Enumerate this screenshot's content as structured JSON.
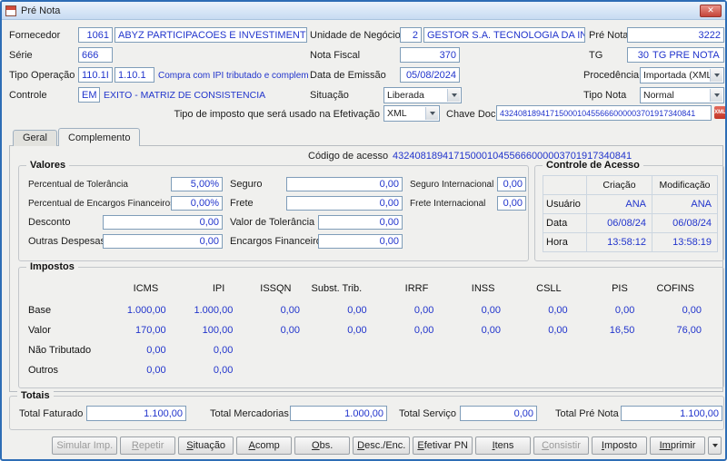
{
  "window": {
    "title": "Pré Nota",
    "close_icon": "✕"
  },
  "header": {
    "fornecedor": {
      "label": "Fornecedor",
      "code": "1061",
      "name": "ABYZ PARTICIPACOES E INVESTIMENTOS LTDA"
    },
    "unidade_negocio": {
      "label": "Unidade de Negócio",
      "code": "2",
      "name": "GESTOR S.A. TECNOLOGIA DA INFORMACA"
    },
    "pre_nota": {
      "label": "Pré Nota",
      "value": "3222"
    },
    "serie": {
      "label": "Série",
      "value": "666"
    },
    "nota_fiscal": {
      "label": "Nota Fiscal",
      "value": "370"
    },
    "tg": {
      "label": "TG",
      "code": "30",
      "name": "TG PRE NOTA POI"
    },
    "tipo_operacao": {
      "label": "Tipo Operação",
      "code1": "110.1I",
      "code2": "1.10.1",
      "desc": "Compra com IPI tributado e complemento"
    },
    "data_emissao": {
      "label": "Data de Emissão",
      "value": "05/08/2024"
    },
    "procedencia": {
      "label": "Procedência",
      "value": "Importada (XML)"
    },
    "controle": {
      "label": "Controle",
      "code": "EM",
      "desc": "EXITO - MATRIZ DE CONSISTENCIA"
    },
    "situacao": {
      "label": "Situação",
      "value": "Liberada"
    },
    "tipo_nota": {
      "label": "Tipo Nota",
      "value": "Normal"
    },
    "tipo_imposto": {
      "label": "Tipo de imposto que será usado na Efetivação",
      "value": "XML"
    },
    "chave_doc": {
      "label": "Chave Doc.",
      "value": "4324081894171500010455666000003701917340841",
      "icon": "XML"
    }
  },
  "tabs": [
    {
      "label": "Geral",
      "active": false
    },
    {
      "label": "Complemento",
      "active": true
    }
  ],
  "complemento": {
    "codigo_acesso": {
      "label": "Código de acesso",
      "value": "4324081894171500010455666000003701917340841"
    },
    "valores": {
      "title": "Valores",
      "percentual_tolerancia": {
        "label": "Percentual de Tolerância",
        "value": "5,00%"
      },
      "percentual_encargos": {
        "label": "Percentual de Encargos Financeiros",
        "value": "0,00%"
      },
      "desconto": {
        "label": "Desconto",
        "value": "0,00"
      },
      "outras_despesas": {
        "label": "Outras Despesas Aces.",
        "value": "0,00"
      },
      "seguro": {
        "label": "Seguro",
        "value": "0,00"
      },
      "frete": {
        "label": "Frete",
        "value": "0,00"
      },
      "valor_tolerancia": {
        "label": "Valor de Tolerância",
        "value": "0,00"
      },
      "encargos_financeiros": {
        "label": "Encargos Financeiros",
        "value": "0,00"
      },
      "seguro_internacional": {
        "label": "Seguro Internacional",
        "value": "0,00"
      },
      "frete_internacional": {
        "label": "Frete Internacional",
        "value": "0,00"
      }
    },
    "controle_acesso": {
      "title": "Controle de Acesso",
      "columns": [
        "Criação",
        "Modificação"
      ],
      "rows": [
        {
          "label": "Usuário",
          "values": [
            "ANA",
            "ANA"
          ]
        },
        {
          "label": "Data",
          "values": [
            "06/08/24",
            "06/08/24"
          ]
        },
        {
          "label": "Hora",
          "values": [
            "13:58:12",
            "13:58:19"
          ]
        }
      ]
    },
    "impostos": {
      "title": "Impostos",
      "columns": [
        "ICMS",
        "IPI",
        "ISSQN",
        "Subst. Trib.",
        "IRRF",
        "INSS",
        "CSLL",
        "PIS",
        "COFINS"
      ],
      "rows": [
        {
          "label": "Base",
          "values": [
            "1.000,00",
            "1.000,00",
            "0,00",
            "0,00",
            "0,00",
            "0,00",
            "0,00",
            "0,00",
            "0,00"
          ]
        },
        {
          "label": "Valor",
          "values": [
            "170,00",
            "100,00",
            "0,00",
            "0,00",
            "0,00",
            "0,00",
            "0,00",
            "16,50",
            "76,00"
          ]
        },
        {
          "label": "Não Tributado",
          "values": [
            "0,00",
            "0,00",
            "",
            "",
            "",
            "",
            "",
            "",
            ""
          ]
        },
        {
          "label": "Outros",
          "values": [
            "0,00",
            "0,00",
            "",
            "",
            "",
            "",
            "",
            "",
            ""
          ]
        }
      ]
    }
  },
  "totais": {
    "title": "Totais",
    "total_faturado": {
      "label": "Total Faturado",
      "value": "1.100,00"
    },
    "total_mercadorias": {
      "label": "Total Mercadorias",
      "value": "1.000,00"
    },
    "total_servico": {
      "label": "Total Serviço",
      "value": "0,00"
    },
    "total_pre_nota": {
      "label": "Total Pré Nota",
      "value": "1.100,00"
    }
  },
  "buttons": [
    {
      "label": "Simular Imp.",
      "key": "",
      "enabled": false
    },
    {
      "label": "Repetir",
      "key": "R",
      "enabled": false
    },
    {
      "label": "Situação",
      "key": "S",
      "enabled": true
    },
    {
      "label": "Acomp",
      "key": "A",
      "enabled": true
    },
    {
      "label": "Obs.",
      "key": "O",
      "enabled": true
    },
    {
      "label": "Desc./Enc.",
      "key": "D",
      "enabled": true
    },
    {
      "label": "Efetivar PN",
      "key": "E",
      "enabled": true
    },
    {
      "label": "Itens",
      "key": "I",
      "enabled": true
    },
    {
      "label": "Consistir",
      "key": "C",
      "enabled": false
    },
    {
      "label": "Imposto",
      "key": "I",
      "enabled": true
    },
    {
      "label": "Imprimir",
      "key": "Im",
      "enabled": true
    }
  ],
  "print_menu_button": {
    "icon": "chevron-down"
  },
  "colors": {
    "value_text": "#2134cc",
    "window_border": "#2e6db5",
    "field_border": "#7f9db9",
    "close_button": "#c5453a",
    "xml_icon": "#c23527",
    "disabled_text": "#9a9a9a"
  }
}
